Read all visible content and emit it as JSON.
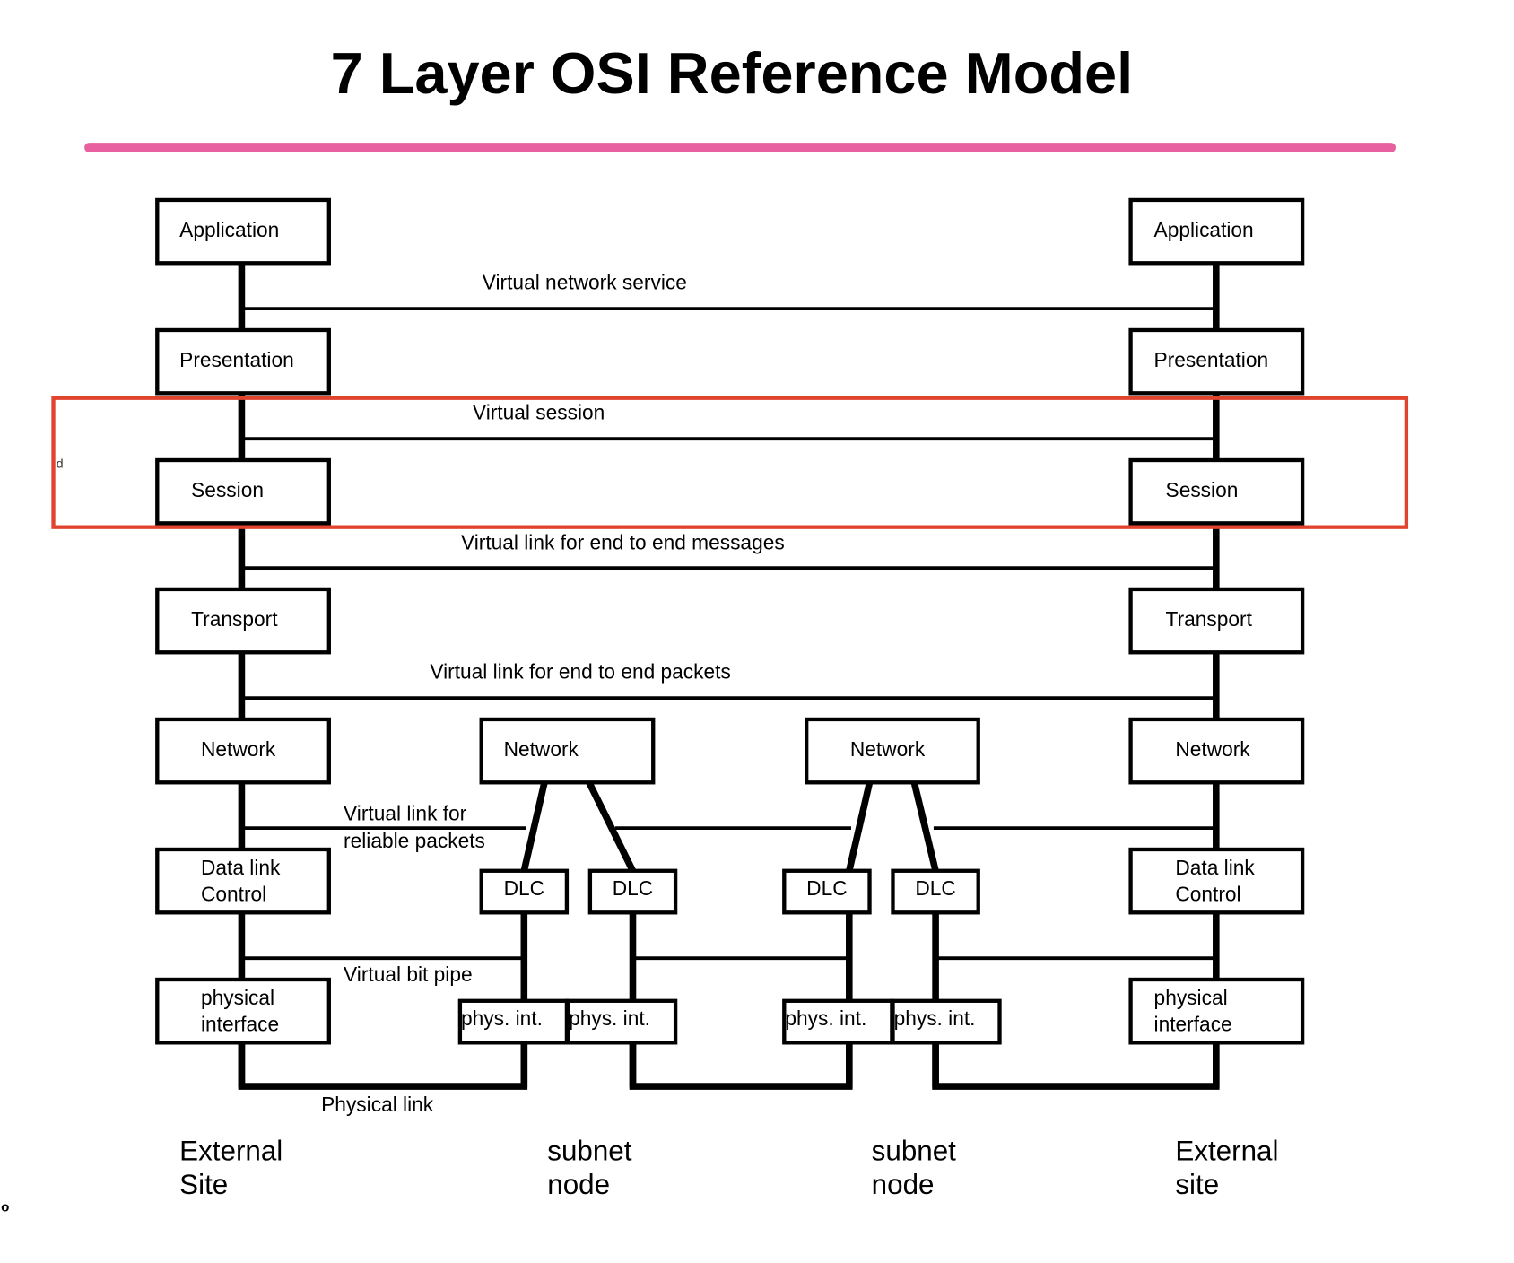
{
  "title": "7 Layer OSI Reference Model",
  "colors": {
    "title_rule": "#e8609f",
    "highlight_box": "#e0442e",
    "line": "#000000"
  },
  "left_stack": {
    "application": "Application",
    "presentation": "Presentation",
    "session": "Session",
    "transport": "Transport",
    "network": "Network",
    "datalink": [
      "Data link",
      "Control"
    ],
    "physical": [
      "physical",
      "interface"
    ]
  },
  "right_stack": {
    "application": "Application",
    "presentation": "Presentation",
    "session": "Session",
    "transport": "Transport",
    "network": "Network",
    "datalink": [
      "Data link",
      "Control"
    ],
    "physical": [
      "physical",
      "interface"
    ]
  },
  "subnet_node_1": {
    "network": "Network",
    "dlc": [
      "DLC",
      "DLC"
    ],
    "phys": [
      "phys. int.",
      "phys. int."
    ]
  },
  "subnet_node_2": {
    "network": "Network",
    "dlc": [
      "DLC",
      "DLC"
    ],
    "phys": [
      "phys. int.",
      "phys. int."
    ]
  },
  "links": {
    "virtual_network_service": "Virtual network service",
    "virtual_session": "Virtual session",
    "virtual_messages": "Virtual link for end to end messages",
    "virtual_packets": "Virtual link for end to end packets",
    "reliable_packets": [
      "Virtual link for",
      "reliable packets"
    ],
    "bit_pipe": "Virtual bit pipe",
    "physical_link": "Physical link"
  },
  "site_labels": [
    [
      "External",
      "Site"
    ],
    [
      "subnet",
      "node"
    ],
    [
      "subnet",
      "node"
    ],
    [
      "External",
      "site"
    ]
  ],
  "stray_marks": {
    "d": "d",
    "o": "o"
  }
}
